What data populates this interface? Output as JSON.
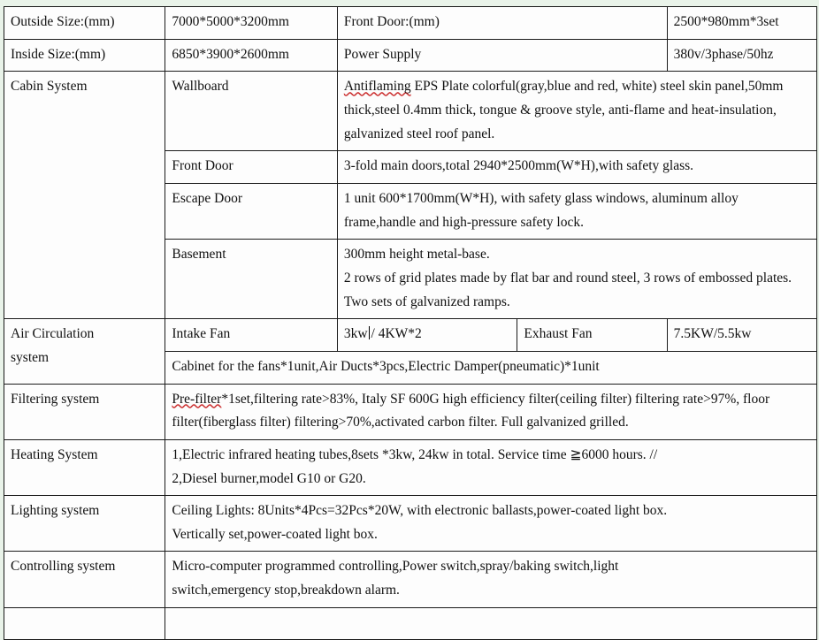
{
  "document": {
    "type": "specification-table",
    "page_background": "#e9f3e9",
    "accent_text_color": "#6a4a9c",
    "spellcheck_underline_color": "#cc3333"
  },
  "rows": {
    "outside_size": {
      "label": "Outside Size:(mm)",
      "value": "7000*5000*3200mm",
      "label2": "Front Door:(mm)",
      "value2": "2500*980mm*3set"
    },
    "inside_size": {
      "label": "Inside Size:(mm)",
      "value": "6850*3900*2600mm",
      "label2": "Power Supply",
      "value2": "380v/3phase/50hz"
    },
    "cabin_system": {
      "label": "Cabin System",
      "items": [
        {
          "name": "Wallboard",
          "spell_error_word": "Antiflaming",
          "desc_rest": " EPS Plate colorful(gray,blue and red, white) steel skin panel,50mm thick,steel 0.4mm thick, tongue & groove style, anti-flame and heat-insulation, galvanized steel roof panel."
        },
        {
          "name": "Front Door",
          "desc": "3-fold main doors,total 2940*2500mm(W*H),with safety glass."
        },
        {
          "name": "Escape Door",
          "desc": "1 unit 600*1700mm(W*H), with safety glass windows, aluminum alloy frame,handle and high-pressure safety lock."
        },
        {
          "name": "Basement",
          "desc_line1": "300mm height metal-base.",
          "desc_line2": "2 rows of grid plates made by flat bar and round steel, 3 rows of embossed plates. Two sets of galvanized ramps."
        }
      ]
    },
    "air_circulation": {
      "label_line1": "Air Circulation",
      "label_line2": "system",
      "intake_fan_label": "Intake Fan",
      "intake_fan_value_before_caret": "3kw",
      "intake_fan_value_after_caret": "/ 4KW*2",
      "exhaust_fan_label": "Exhaust Fan",
      "exhaust_fan_value": "7.5KW/5.5kw",
      "cabinet_desc": "Cabinet for the fans*1unit,Air Ducts*3pcs,Electric Damper(pneumatic)*1unit"
    },
    "filtering_system": {
      "label": "Filtering system",
      "spell_error_word": "Pre-filter",
      "desc_rest": "*1set,filtering rate>83%, Italy SF 600G high efficiency filter(ceiling filter) filtering rate>97%, floor filter(fiberglass filter) filtering>70%,activated carbon filter. Full galvanized grilled."
    },
    "heating_system": {
      "label": "Heating System",
      "line1": "1,Electric infrared heating tubes,8sets *3kw, 24kw in total. Service time ≧6000 hours. //",
      "line2": "2,Diesel burner,model G10 or G20."
    },
    "lighting_system": {
      "label": "Lighting system",
      "line1": "Ceiling Lights: 8Units*4Pcs=32Pcs*20W, with electronic ballasts,power-coated light box.",
      "line2": "Vertically set,power-coated light box."
    },
    "controlling_system": {
      "label": "Controlling system",
      "line1": "Micro-computer programmed controlling,Power switch,spray/baking switch,light",
      "line2": "switch,emergency stop,breakdown alarm."
    }
  }
}
